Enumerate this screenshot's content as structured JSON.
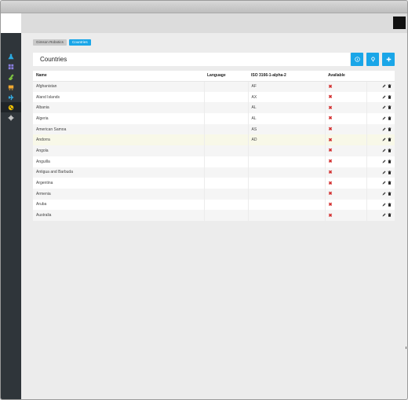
{
  "breadcrumb": [
    "Gimson Robotics",
    "Countries"
  ],
  "page": {
    "title": "Countries"
  },
  "actions": [
    "info-icon",
    "pin-icon",
    "add-icon"
  ],
  "sidebar": {
    "items": [
      {
        "icon": "flask-icon",
        "color": "#2aa9e0"
      },
      {
        "icon": "grid-icon",
        "color": "#8a7fe0"
      },
      {
        "icon": "plug-icon",
        "color": "#7cc142"
      },
      {
        "icon": "cart-icon",
        "color": "#f0a830"
      },
      {
        "icon": "plane-icon",
        "color": "#35b6f0"
      },
      {
        "icon": "globe-icon",
        "color": "#f2c200",
        "active": true
      },
      {
        "icon": "gear-icon",
        "color": "#c9c9c9"
      }
    ]
  },
  "table": {
    "columns": [
      "Name",
      "Language",
      "ISO 3166-1-alpha-2",
      "Available",
      ""
    ],
    "rows": [
      {
        "name": "Afghanistan",
        "language": "",
        "iso": "AF",
        "available": "✖"
      },
      {
        "name": "Aland Islands",
        "language": "",
        "iso": "AX",
        "available": "✖"
      },
      {
        "name": "Albania",
        "language": "",
        "iso": "AL",
        "available": "✖"
      },
      {
        "name": "Algeria",
        "language": "",
        "iso": "AL",
        "available": "✖"
      },
      {
        "name": "American Samoa",
        "language": "",
        "iso": "AS",
        "available": "✖"
      },
      {
        "name": "Andorra",
        "language": "",
        "iso": "AD",
        "available": "✖"
      },
      {
        "name": "Angola",
        "language": "",
        "iso": "",
        "available": "✖"
      },
      {
        "name": "Anguilla",
        "language": "",
        "iso": "",
        "available": "✖"
      },
      {
        "name": "Antigua and Barbuda",
        "language": "",
        "iso": "",
        "available": "✖"
      },
      {
        "name": "Argentina",
        "language": "",
        "iso": "",
        "available": "✖"
      },
      {
        "name": "Armenia",
        "language": "",
        "iso": "",
        "available": "✖"
      },
      {
        "name": "Aruba",
        "language": "",
        "iso": "",
        "available": "✖"
      },
      {
        "name": "Australia",
        "language": "",
        "iso": "",
        "available": "✖"
      }
    ]
  }
}
